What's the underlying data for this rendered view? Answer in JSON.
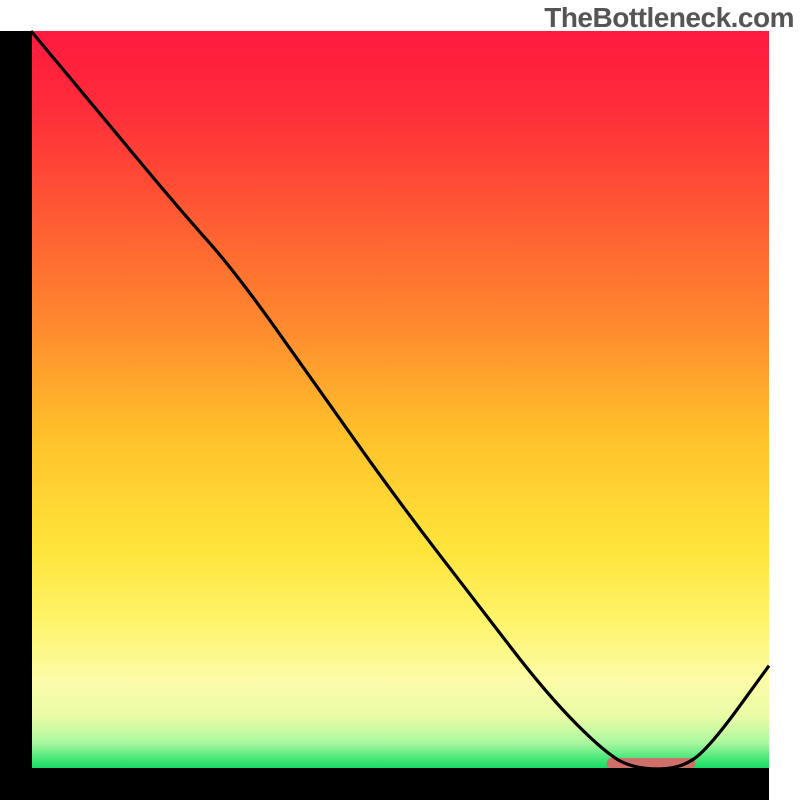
{
  "watermark": "TheBottleneck.com",
  "chart_data": {
    "type": "line",
    "title": "",
    "xlabel": "",
    "ylabel": "",
    "xlim": [
      0,
      100
    ],
    "ylim": [
      0,
      100
    ],
    "curve": {
      "name": "bottleneck-curve",
      "x": [
        0,
        10,
        20,
        28,
        40,
        50,
        60,
        70,
        78,
        82,
        88,
        92,
        100
      ],
      "y": [
        100,
        88,
        76,
        67,
        50,
        36,
        23,
        10,
        2,
        0,
        0,
        3,
        14
      ]
    },
    "optimal_band": {
      "x_start": 78,
      "x_end": 90,
      "color": "#cf6f6a"
    },
    "gradient_stops": [
      {
        "offset": 0.0,
        "color": "#ff1a3f"
      },
      {
        "offset": 0.1,
        "color": "#ff2b3a"
      },
      {
        "offset": 0.25,
        "color": "#ff5a33"
      },
      {
        "offset": 0.4,
        "color": "#ff8a2e"
      },
      {
        "offset": 0.55,
        "color": "#ffc22a"
      },
      {
        "offset": 0.7,
        "color": "#ffe43a"
      },
      {
        "offset": 0.8,
        "color": "#fff46a"
      },
      {
        "offset": 0.88,
        "color": "#fcfca8"
      },
      {
        "offset": 0.93,
        "color": "#e9fca6"
      },
      {
        "offset": 0.965,
        "color": "#a9f7a0"
      },
      {
        "offset": 0.985,
        "color": "#4be879"
      },
      {
        "offset": 1.0,
        "color": "#14d964"
      }
    ]
  },
  "frame": {
    "outer": 800,
    "plot_left": 31,
    "plot_top": 31,
    "plot_size": 738,
    "axis_thickness": 31
  }
}
